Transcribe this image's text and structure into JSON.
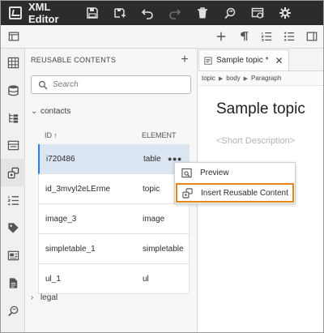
{
  "app": {
    "title": "XML Editor"
  },
  "panel": {
    "header": "REUSABLE CONTENTS",
    "search_placeholder": "Search",
    "group_expanded": "contacts",
    "group_collapsed": "legal",
    "columns": {
      "id": "ID",
      "element": "ELEMENT"
    },
    "rows": [
      {
        "id": "i720486",
        "element": "table"
      },
      {
        "id": "id_3mvyl2eLErme",
        "element": "topic"
      },
      {
        "id": "image_3",
        "element": "image"
      },
      {
        "id": "simpletable_1",
        "element": "simpletable"
      },
      {
        "id": "ul_1",
        "element": "ul"
      }
    ]
  },
  "context_menu": {
    "items": [
      "Preview",
      "Insert Reusable Content"
    ]
  },
  "editor": {
    "tab_label": "Sample topic *",
    "breadcrumb": [
      "topic",
      "body",
      "Paragraph"
    ],
    "doc_title": "Sample topic",
    "short_description": "<Short Description>"
  },
  "colors": {
    "titlebar": "#2c2c2c",
    "selection": "#dce6f3",
    "selection_accent": "#2680eb",
    "highlight_border": "#e68619"
  }
}
